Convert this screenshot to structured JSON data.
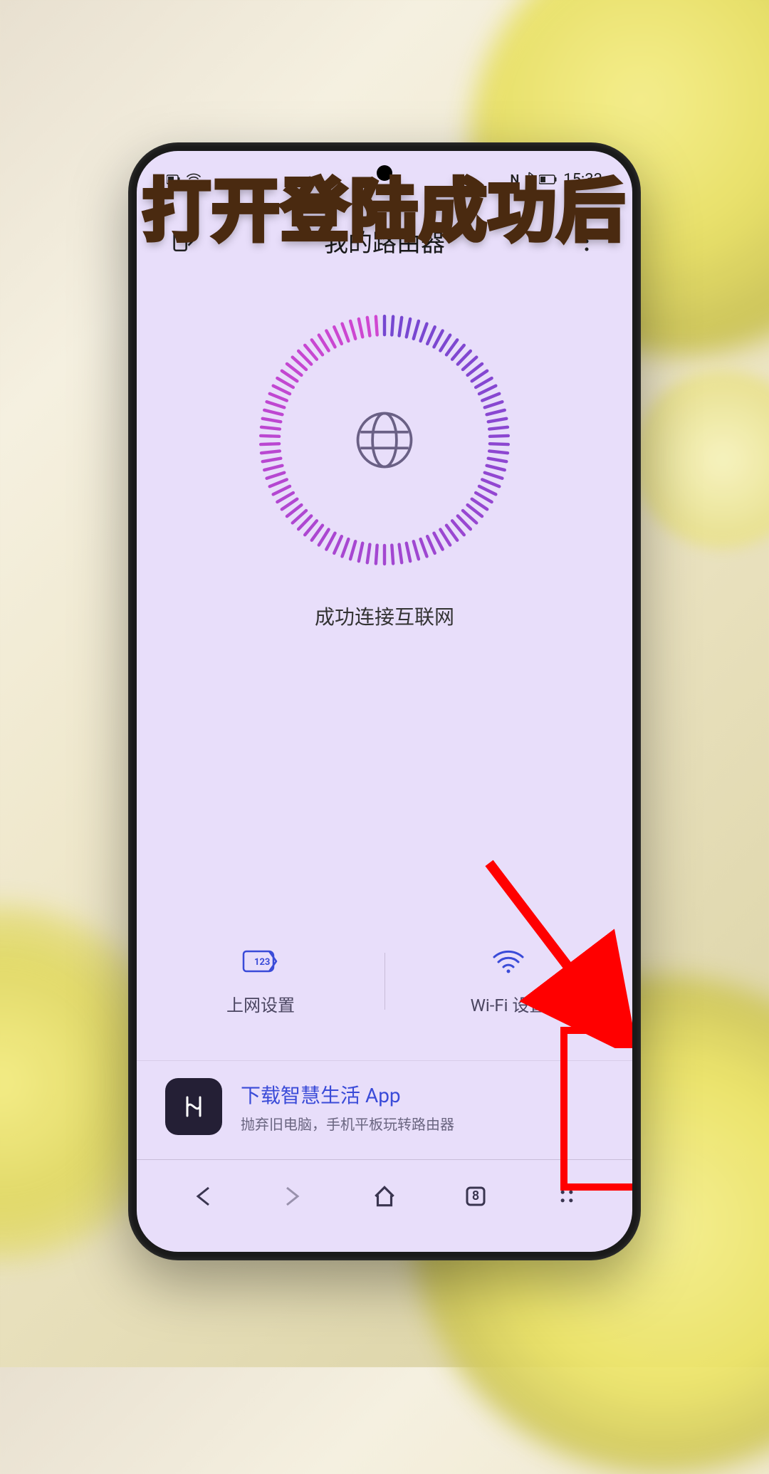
{
  "caption": "打开登陆成功后",
  "status_bar": {
    "time": "15:33",
    "left_icons": [
      "battery-icon",
      "wifi-icon"
    ],
    "right_icons": [
      "nfc-icon",
      "bluetooth-icon",
      "battery-icon"
    ]
  },
  "app_header": {
    "title": "我的路由器",
    "exit_icon": "exit-icon",
    "more_icon": "more-icon"
  },
  "dial": {
    "status_text": "成功连接互联网",
    "center_icon": "globe-icon"
  },
  "options": [
    {
      "icon": "network-settings-icon",
      "label": "上网设置"
    },
    {
      "icon": "wifi-settings-icon",
      "label": "Wi-Fi 设置"
    }
  ],
  "promo": {
    "app_icon": "hilink-icon",
    "title": "下载智慧生活 App",
    "subtitle": "抛弃旧电脑，手机平板玩转路由器"
  },
  "browser_bar": {
    "back": "back-icon",
    "forward": "forward-icon",
    "home": "home-icon",
    "tabs_count": "8",
    "menu": "menu-icon"
  },
  "annotation": {
    "arrow_target": "wifi-settings-option"
  }
}
